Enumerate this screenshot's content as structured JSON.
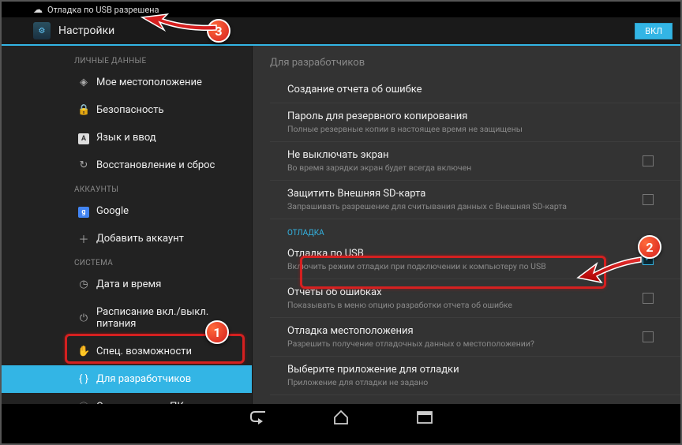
{
  "statusbar": {
    "notification": "Отладка по USB разрешена"
  },
  "titlebar": {
    "title": "Настройки",
    "toggle": "ВКЛ"
  },
  "sidebar": {
    "sections": [
      {
        "header": "ЛИЧНЫЕ ДАННЫЕ",
        "items": [
          {
            "icon": "◈",
            "label": "Мое местоположение"
          },
          {
            "icon": "🔒",
            "label": "Безопасность"
          },
          {
            "icon": "A",
            "label": "Язык и ввод",
            "iconClass": "lang-icon"
          },
          {
            "icon": "↻",
            "label": "Восстановление и сброс"
          }
        ]
      },
      {
        "header": "АККАУНТЫ",
        "items": [
          {
            "icon": "g",
            "label": "Google",
            "iconClass": "google-icon"
          },
          {
            "icon": "＋",
            "label": "Добавить аккаунт"
          }
        ]
      },
      {
        "header": "СИСТЕМА",
        "items": [
          {
            "icon": "◷",
            "label": "Дата и время"
          },
          {
            "icon": "⏻",
            "label": "Расписание вкл./выкл. питания"
          },
          {
            "icon": "✋",
            "label": "Спец. возможности"
          },
          {
            "icon": "{ }",
            "label": "Для разработчиков",
            "selected": true
          },
          {
            "icon": "ⓘ",
            "label": "О планшетном ПК"
          }
        ]
      }
    ]
  },
  "content": {
    "header": "Для разработчиков",
    "settings": [
      {
        "title": "Создание отчета об ошибке"
      },
      {
        "title": "Пароль для резервного копирования",
        "sub": "Полные резервные копии в настоящее время не защищены"
      },
      {
        "title": "Не выключать экран",
        "sub": "Во время зарядки экран будет всегда включен",
        "checkbox": true,
        "checked": false
      },
      {
        "title": "Защитить Внешняя SD-карта",
        "sub": "Запрашивать разрешение для считывания данных с Внешняя SD-карта",
        "checkbox": true,
        "checked": false
      },
      {
        "group": "ОТЛАДКА"
      },
      {
        "title": "Отладка по USB",
        "sub": "Включить режим отладки при подключении к компьютеру по USB",
        "checkbox": true,
        "checked": true
      },
      {
        "title": "Отчеты об ошибках",
        "sub": "Показывать в меню опцию разработки отчета об ошибке",
        "checkbox": true,
        "checked": false
      },
      {
        "title": "Отладка местоположения",
        "sub": "Разрешить получение отладочных данных о местоположении?",
        "checkbox": true,
        "checked": false
      },
      {
        "title": "Выберите приложение для отладки",
        "sub": "Приложение для отладки не задано"
      }
    ]
  },
  "badges": {
    "b1": "1",
    "b2": "2",
    "b3": "3"
  }
}
